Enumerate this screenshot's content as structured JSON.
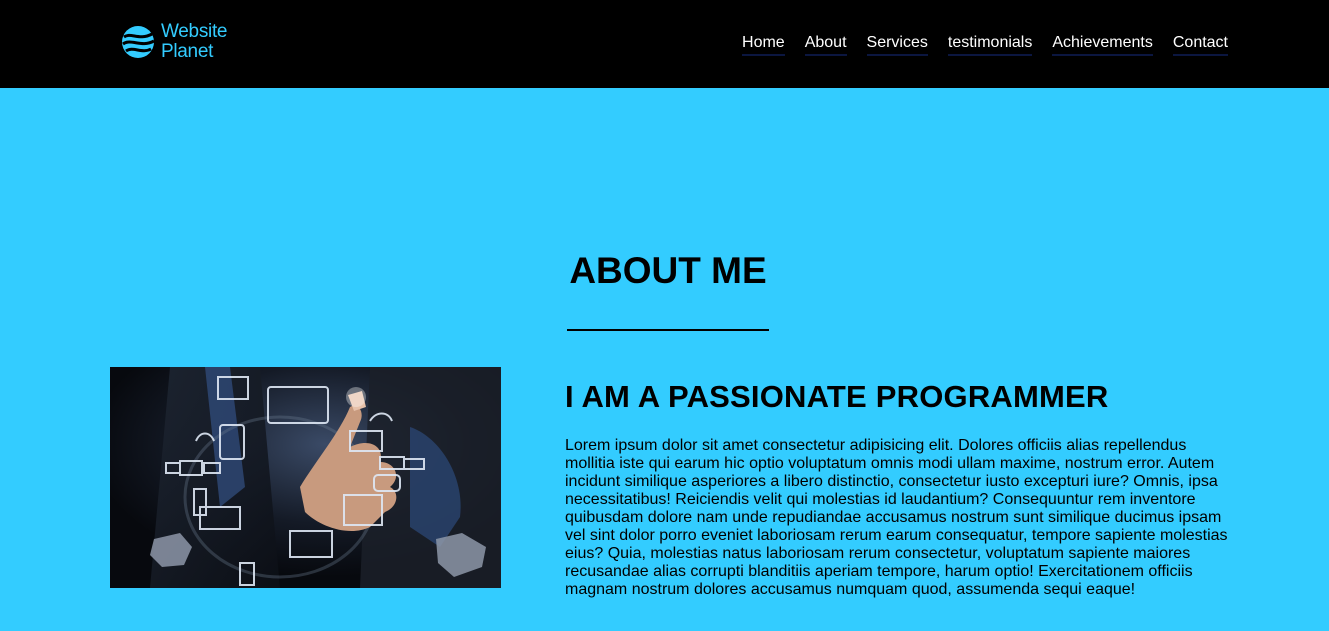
{
  "brand": {
    "line1": "Website",
    "line2": "Planet",
    "logo_icon": "globe-waves-icon",
    "color": "#33ccff"
  },
  "nav": {
    "items": [
      {
        "label": "Home"
      },
      {
        "label": "About"
      },
      {
        "label": "Services"
      },
      {
        "label": "testimonials"
      },
      {
        "label": "Achievements"
      },
      {
        "label": "Contact"
      }
    ]
  },
  "about": {
    "title": "ABOUT ME",
    "heading": "I AM A PASSIONATE PROGRAMMER",
    "paragraph": "Lorem ipsum dolor sit amet consectetur adipisicing elit. Dolores officiis alias repellendus mollitia iste qui earum hic optio voluptatum omnis modi ullam maxime, nostrum error. Autem incidunt similique asperiores a libero distinctio, consectetur iusto excepturi iure? Omnis, ipsa necessitatibus! Reiciendis velit qui molestias id laudantium? Consequuntur rem inventore quibusdam dolore nam unde repudiandae accusamus nostrum sunt similique ducimus ipsam vel sint dolor porro eveniet laboriosam rerum earum consequatur, tempore sapiente molestias eius? Quia, molestias natus laboriosam rerum consectetur, voluptatum sapiente maiores recusandae alias corrupti blanditiis aperiam tempore, harum optio! Exercitationem officiis magnam nostrum dolores accusamus numquam quod, assumenda sequi eaque!",
    "image_subject": "hand-touching-tech-icons-photo"
  },
  "colors": {
    "page_background": "#33ccff",
    "navbar_background": "#000000",
    "nav_text": "#ffffff"
  }
}
